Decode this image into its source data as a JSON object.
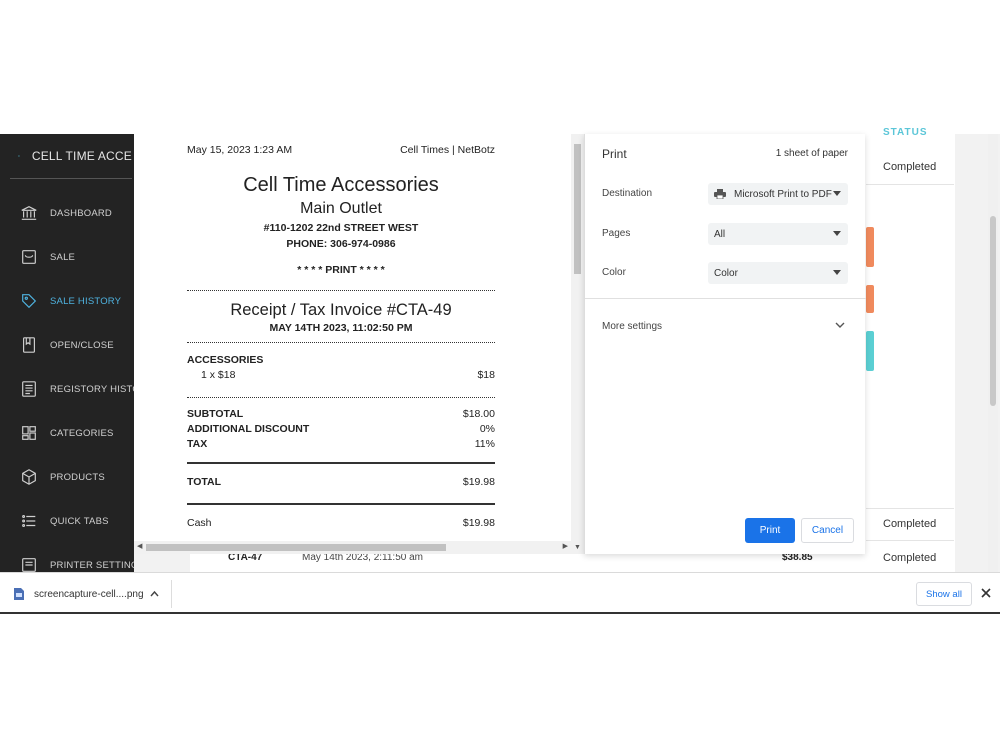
{
  "app": {
    "brand": "CELL TIME ACCE",
    "nav": [
      {
        "label": "DASHBOARD",
        "icon": "bank-icon"
      },
      {
        "label": "SALE",
        "icon": "bag-icon"
      },
      {
        "label": "SALE HISTORY",
        "icon": "tag-icon",
        "active": true
      },
      {
        "label": "OPEN/CLOSE",
        "icon": "book-icon"
      },
      {
        "label": "REGISTORY HISTORY",
        "icon": "register-icon"
      },
      {
        "label": "CATEGORIES",
        "icon": "layout-icon"
      },
      {
        "label": "PRODUCTS",
        "icon": "box-icon"
      },
      {
        "label": "QUICK TABS",
        "icon": "list-icon"
      },
      {
        "label": "PRINTER SETTINGS",
        "icon": "printer-icon"
      }
    ],
    "accent": "#4fb3e0"
  },
  "background_table": {
    "status_header": "STATUS",
    "statuses": [
      "Completed",
      "Completed",
      "Completed"
    ],
    "row": {
      "id": "CTA-47",
      "date": "May 14th 2023, 2:11:50 am",
      "amount": "$38.85"
    }
  },
  "receipt": {
    "printed_at": "May 15, 2023 1:23 AM",
    "source": "Cell Times | NetBotz",
    "shop_name": "Cell Time Accessories",
    "outlet": "Main Outlet",
    "address": "#110-1202 22nd STREET WEST",
    "phone": "PHONE: 306-974-0986",
    "print_mark": "* * * * PRINT * * * *",
    "invoice_title": "Receipt / Tax Invoice #CTA-49",
    "invoice_date": "MAY 14TH 2023, 11:02:50 PM",
    "category": "ACCESSORIES",
    "item_qty": "1 x $18",
    "item_price": "$18",
    "subtotal_label": "SUBTOTAL",
    "subtotal_value": "$18.00",
    "discount_label": "ADDITIONAL DISCOUNT",
    "discount_value": "0%",
    "tax_label": "TAX",
    "tax_value": "11%",
    "total_label": "TOTAL",
    "total_value": "$19.98",
    "payment_label": "Cash",
    "payment_value": "$19.98"
  },
  "print_dialog": {
    "title": "Print",
    "sheets": "1 sheet of paper",
    "destination_label": "Destination",
    "destination_value": "Microsoft Print to PDF",
    "pages_label": "Pages",
    "pages_value": "All",
    "color_label": "Color",
    "color_value": "Color",
    "more_settings": "More settings",
    "print_button": "Print",
    "cancel_button": "Cancel",
    "primary_color": "#1a73e8"
  },
  "download_bar": {
    "filename": "screencapture-cell....png",
    "show_all": "Show all"
  }
}
